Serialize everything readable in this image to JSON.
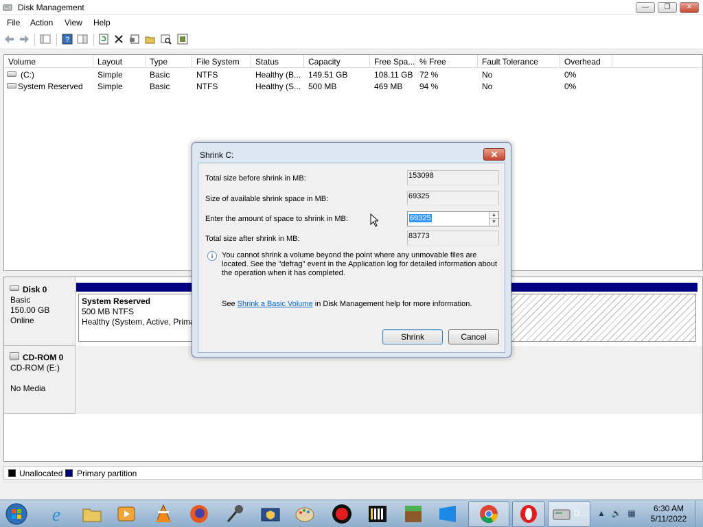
{
  "window": {
    "title": "Disk Management",
    "min_glyph": "—",
    "max_glyph": "❐",
    "close_glyph": "✕"
  },
  "menu": {
    "file": "File",
    "action": "Action",
    "view": "View",
    "help": "Help"
  },
  "volume_list": {
    "columns": [
      "Volume",
      "Layout",
      "Type",
      "File System",
      "Status",
      "Capacity",
      "Free Spa...",
      "% Free",
      "Fault Tolerance",
      "Overhead"
    ],
    "rows": [
      [
        "(C:)",
        "Simple",
        "Basic",
        "NTFS",
        "Healthy (B...",
        "149.51 GB",
        "108.11 GB",
        "72 %",
        "No",
        "0%"
      ],
      [
        "System Reserved",
        "Simple",
        "Basic",
        "NTFS",
        "Healthy (S...",
        "500 MB",
        "469 MB",
        "94 %",
        "No",
        "0%"
      ]
    ]
  },
  "disk0": {
    "name": "Disk 0",
    "type": "Basic",
    "size": "150.00 GB",
    "status": "Online",
    "partition": {
      "name": "System Reserved",
      "fs": "500 MB NTFS",
      "health": "Healthy (System, Active, Prima"
    }
  },
  "cdrom0": {
    "name": "CD-ROM 0",
    "drive": "CD-ROM (E:)",
    "media": "No Media"
  },
  "legend": {
    "unallocated": "Unallocated",
    "primary": "Primary partition",
    "unallocated_color": "#000000",
    "primary_color": "#000080"
  },
  "dialog": {
    "title": "Shrink C:",
    "total_before_label": "Total size before shrink in MB:",
    "total_before_value": "153098",
    "available_label": "Size of available shrink space in MB:",
    "available_value": "69325",
    "amount_label": "Enter the amount of space to shrink in MB:",
    "amount_value": "69325",
    "total_after_label": "Total size after shrink in MB:",
    "total_after_value": "83773",
    "info_text": "You cannot shrink a volume beyond the point where any unmovable files are located. See the \"defrag\" event in the Application log for detailed information about the operation when it has completed.",
    "help_prefix": "See",
    "help_link": "Shrink a Basic Volume",
    "help_suffix": "in Disk Management help for more information.",
    "shrink_button": "Shrink",
    "cancel_button": "Cancel"
  },
  "taskbar": {
    "active_label": "D...",
    "time": "6:30 AM",
    "date": "5/11/2022"
  }
}
